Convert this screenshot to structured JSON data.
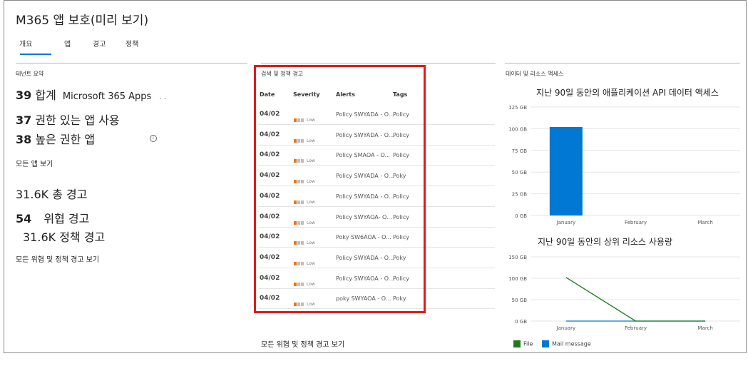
{
  "header": {
    "title": "M365 앱 보호(미리 보기)"
  },
  "tabs": [
    {
      "label": "개요"
    },
    {
      "label": "앱"
    },
    {
      "label": "경고"
    },
    {
      "label": "정책"
    }
  ],
  "tenant_summary": {
    "heading": "테넌트 요약",
    "total_count": "39",
    "total_label": "합계",
    "total_apps": "Microsoft 365 Apps",
    "ellipsis": ". .",
    "permitted_count": "37",
    "permitted_label": "권한 있는 앱 사용",
    "high_priv_count": "38",
    "high_priv_label": "높은 권한 앱",
    "view_all_apps": "모든 앱 보기",
    "total_alerts": "31.6K 총 경고",
    "threat_count": "54",
    "threat_label": "위협 경고",
    "policy_alerts": "31.6K 정책 경고",
    "view_all_alerts": "모든 위협 및 정책 경고 보기"
  },
  "alerts": {
    "heading": "검색 및 정책 경고",
    "columns": [
      "Date",
      "Severity",
      "Alerts",
      "Tags"
    ],
    "rows": [
      {
        "date": "04/02",
        "severity": "Low",
        "alert": "Policy SWYADA - O...",
        "tag": "Policy"
      },
      {
        "date": "04/02",
        "severity": "Low",
        "alert": "Policy SWYADA - O...",
        "tag": "Policy"
      },
      {
        "date": "04/02",
        "severity": "Low",
        "alert": "Policy SMAOA  - O...",
        "tag": "Policy"
      },
      {
        "date": "04/02",
        "severity": "Low",
        "alert": "Policy SWYADA - O...",
        "tag": "Poky"
      },
      {
        "date": "04/02",
        "severity": "Low",
        "alert": "Policy SWYADA - O...",
        "tag": "Policy"
      },
      {
        "date": "04/02",
        "severity": "Low",
        "alert": "Policy SWYAOA- O...",
        "tag": "Policy"
      },
      {
        "date": "04/02",
        "severity": "Low",
        "alert": "Poky SW6AOA - O...",
        "tag": "Policy"
      },
      {
        "date": "04/02",
        "severity": "Low",
        "alert": "Policy SWYADA - O...",
        "tag": "Poky"
      },
      {
        "date": "04/02",
        "severity": "Low",
        "alert": "Policy SWYAOA - O...",
        "tag": "Policy"
      },
      {
        "date": "04/02",
        "severity": "Low",
        "alert": "poky SWYAOA - O...",
        "tag": "Poky"
      }
    ],
    "view_all": "모든 위협 및 정책 경고 보기"
  },
  "data_access": {
    "heading": "데이터 및 리소스 액세스"
  },
  "colors": {
    "accent": "#0078d4",
    "severity": "#e8761c",
    "highlight": "#e01a1a",
    "file": "#1e7b1e"
  },
  "chart_data": [
    {
      "type": "bar",
      "title": "지난 90일 동안의 애플리케이션 API 데이터 액세스",
      "categories": [
        "January",
        "February",
        "March"
      ],
      "values": [
        102,
        0,
        0
      ],
      "yticks": [
        "0 GB",
        "25 GB",
        "50 GB",
        "75 GB",
        "100 GB",
        "125 GB"
      ],
      "ylim": [
        0,
        125
      ],
      "grid": true
    },
    {
      "type": "line",
      "title": "지난 90일 동안의 상위 리소스 사용량",
      "categories": [
        "January",
        "February",
        "March"
      ],
      "yticks": [
        "0 GB",
        "50 GB",
        "100 GB",
        "150 GB"
      ],
      "ylim": [
        0,
        150
      ],
      "grid": true,
      "series": [
        {
          "name": "File",
          "values": [
            102,
            0,
            0
          ],
          "color": "#1e7b1e"
        },
        {
          "name": "Mail message",
          "values": [
            0,
            0,
            0
          ],
          "color": "#0078d4"
        }
      ],
      "legend": "bottom-left"
    }
  ]
}
